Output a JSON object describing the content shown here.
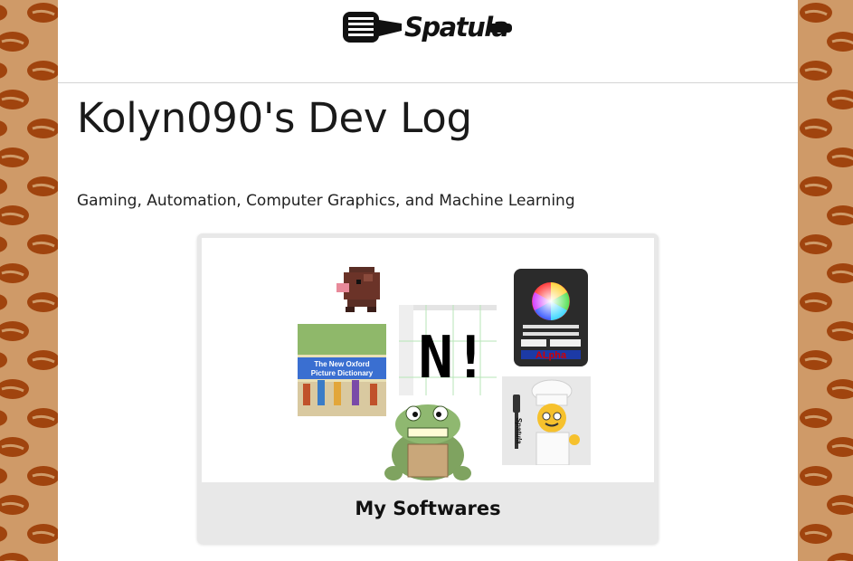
{
  "header": {
    "logo_text": "Spatula"
  },
  "main": {
    "title": "Kolyn090's Dev Log",
    "tagline": "Gaming, Automation, Computer Graphics, and Machine Learning"
  },
  "card": {
    "caption": "My Softwares",
    "collage": {
      "dictionary_line1": "The New Oxford",
      "dictionary_line2": "Picture Dictionary",
      "n_glyph": "N!",
      "alpha_label": "ALpha",
      "chef_spatula_text": "Spatula"
    }
  },
  "colors": {
    "background_tan": "#cf9a68",
    "bean_brown": "#a0440e",
    "page_white": "#ffffff",
    "card_gray": "#e8e8e8"
  }
}
